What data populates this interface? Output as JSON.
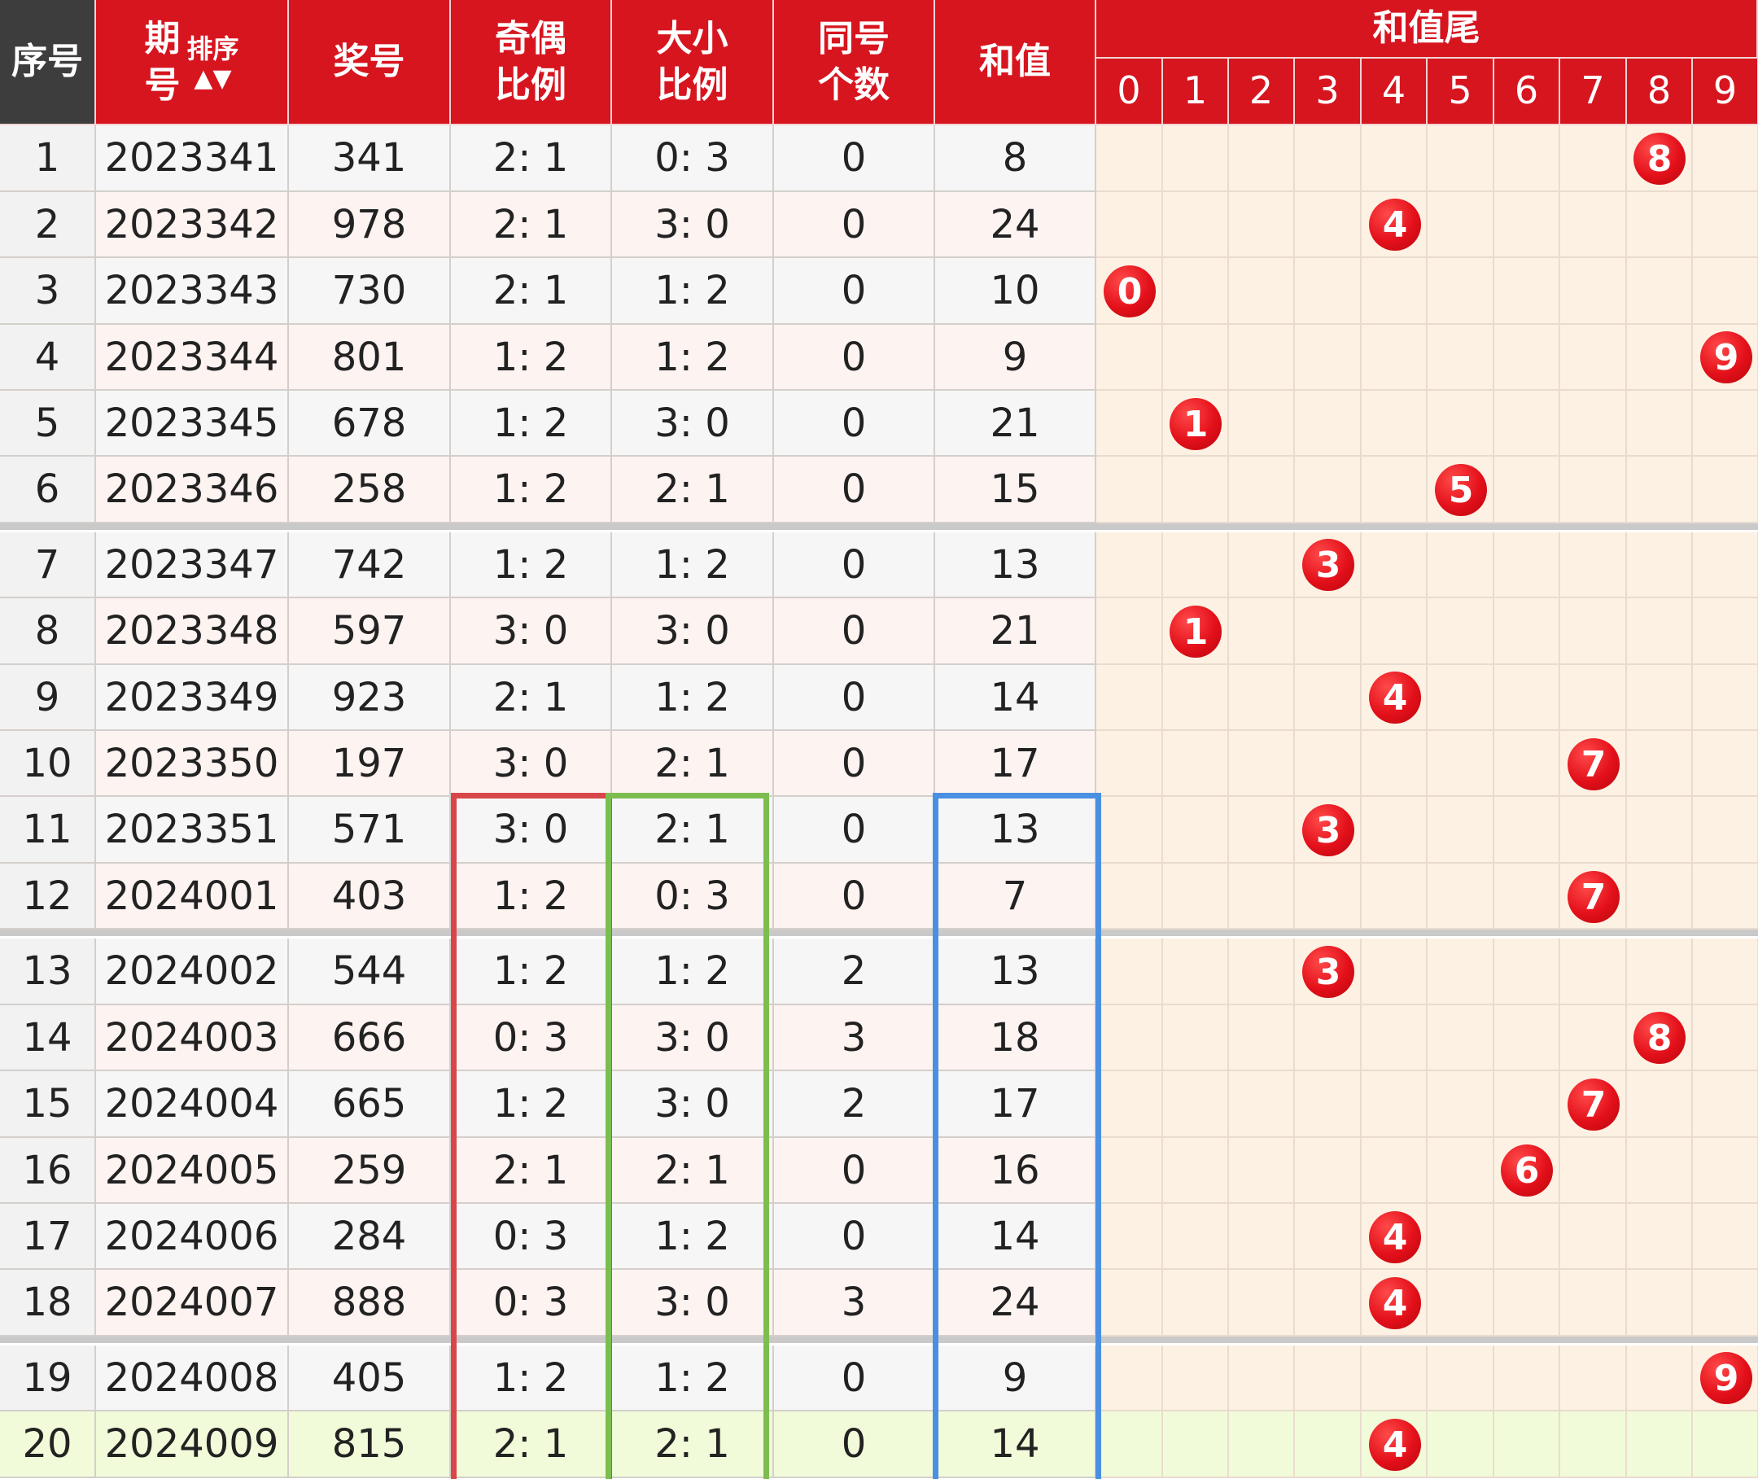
{
  "header": {
    "seq": "序号",
    "period_top": "期",
    "period_bottom": "号",
    "sort_label": "排序",
    "sort_arrows": "▲▼",
    "number": "奖号",
    "odd_even_top": "奇偶",
    "odd_even_bottom": "比例",
    "big_small_top": "大小",
    "big_small_bottom": "比例",
    "same_top": "同号",
    "same_bottom": "个数",
    "sum": "和值",
    "sum_tail": "和值尾",
    "tail_digits": [
      "0",
      "1",
      "2",
      "3",
      "4",
      "5",
      "6",
      "7",
      "8",
      "9"
    ]
  },
  "colors": {
    "header_red": "#d7151f",
    "header_dark": "#3d3d3d",
    "ball_red": "#e3101a",
    "row_light": "#f6f6f6",
    "row_pink": "#fdf3f1",
    "tail_bg": "#fdf1e3",
    "highlight_row": "#f1fbd9",
    "box_odd_even": "#d9464a",
    "box_big_small": "#7dbd4f",
    "box_sum": "#4a90e2"
  },
  "rows": [
    {
      "seq": "1",
      "period": "2023341",
      "number": "341",
      "odd_even": "2: 1",
      "big_small": "0: 3",
      "same": "0",
      "sum": "8",
      "tail": "8"
    },
    {
      "seq": "2",
      "period": "2023342",
      "number": "978",
      "odd_even": "2: 1",
      "big_small": "3: 0",
      "same": "0",
      "sum": "24",
      "tail": "4"
    },
    {
      "seq": "3",
      "period": "2023343",
      "number": "730",
      "odd_even": "2: 1",
      "big_small": "1: 2",
      "same": "0",
      "sum": "10",
      "tail": "0"
    },
    {
      "seq": "4",
      "period": "2023344",
      "number": "801",
      "odd_even": "1: 2",
      "big_small": "1: 2",
      "same": "0",
      "sum": "9",
      "tail": "9"
    },
    {
      "seq": "5",
      "period": "2023345",
      "number": "678",
      "odd_even": "1: 2",
      "big_small": "3: 0",
      "same": "0",
      "sum": "21",
      "tail": "1"
    },
    {
      "seq": "6",
      "period": "2023346",
      "number": "258",
      "odd_even": "1: 2",
      "big_small": "2: 1",
      "same": "0",
      "sum": "15",
      "tail": "5"
    },
    {
      "seq": "7",
      "period": "2023347",
      "number": "742",
      "odd_even": "1: 2",
      "big_small": "1: 2",
      "same": "0",
      "sum": "13",
      "tail": "3"
    },
    {
      "seq": "8",
      "period": "2023348",
      "number": "597",
      "odd_even": "3: 0",
      "big_small": "3: 0",
      "same": "0",
      "sum": "21",
      "tail": "1"
    },
    {
      "seq": "9",
      "period": "2023349",
      "number": "923",
      "odd_even": "2: 1",
      "big_small": "1: 2",
      "same": "0",
      "sum": "14",
      "tail": "4"
    },
    {
      "seq": "10",
      "period": "2023350",
      "number": "197",
      "odd_even": "3: 0",
      "big_small": "2: 1",
      "same": "0",
      "sum": "17",
      "tail": "7"
    },
    {
      "seq": "11",
      "period": "2023351",
      "number": "571",
      "odd_even": "3: 0",
      "big_small": "2: 1",
      "same": "0",
      "sum": "13",
      "tail": "3"
    },
    {
      "seq": "12",
      "period": "2024001",
      "number": "403",
      "odd_even": "1: 2",
      "big_small": "0: 3",
      "same": "0",
      "sum": "7",
      "tail": "7"
    },
    {
      "seq": "13",
      "period": "2024002",
      "number": "544",
      "odd_even": "1: 2",
      "big_small": "1: 2",
      "same": "2",
      "sum": "13",
      "tail": "3"
    },
    {
      "seq": "14",
      "period": "2024003",
      "number": "666",
      "odd_even": "0: 3",
      "big_small": "3: 0",
      "same": "3",
      "sum": "18",
      "tail": "8"
    },
    {
      "seq": "15",
      "period": "2024004",
      "number": "665",
      "odd_even": "1: 2",
      "big_small": "3: 0",
      "same": "2",
      "sum": "17",
      "tail": "7"
    },
    {
      "seq": "16",
      "period": "2024005",
      "number": "259",
      "odd_even": "2: 1",
      "big_small": "2: 1",
      "same": "0",
      "sum": "16",
      "tail": "6"
    },
    {
      "seq": "17",
      "period": "2024006",
      "number": "284",
      "odd_even": "0: 3",
      "big_small": "1: 2",
      "same": "0",
      "sum": "14",
      "tail": "4"
    },
    {
      "seq": "18",
      "period": "2024007",
      "number": "888",
      "odd_even": "0: 3",
      "big_small": "3: 0",
      "same": "3",
      "sum": "24",
      "tail": "4"
    },
    {
      "seq": "19",
      "period": "2024008",
      "number": "405",
      "odd_even": "1: 2",
      "big_small": "1: 2",
      "same": "0",
      "sum": "9",
      "tail": "9"
    },
    {
      "seq": "20",
      "period": "2024009",
      "number": "815",
      "odd_even": "2: 1",
      "big_small": "2: 1",
      "same": "0",
      "sum": "14",
      "tail": "4"
    }
  ]
}
